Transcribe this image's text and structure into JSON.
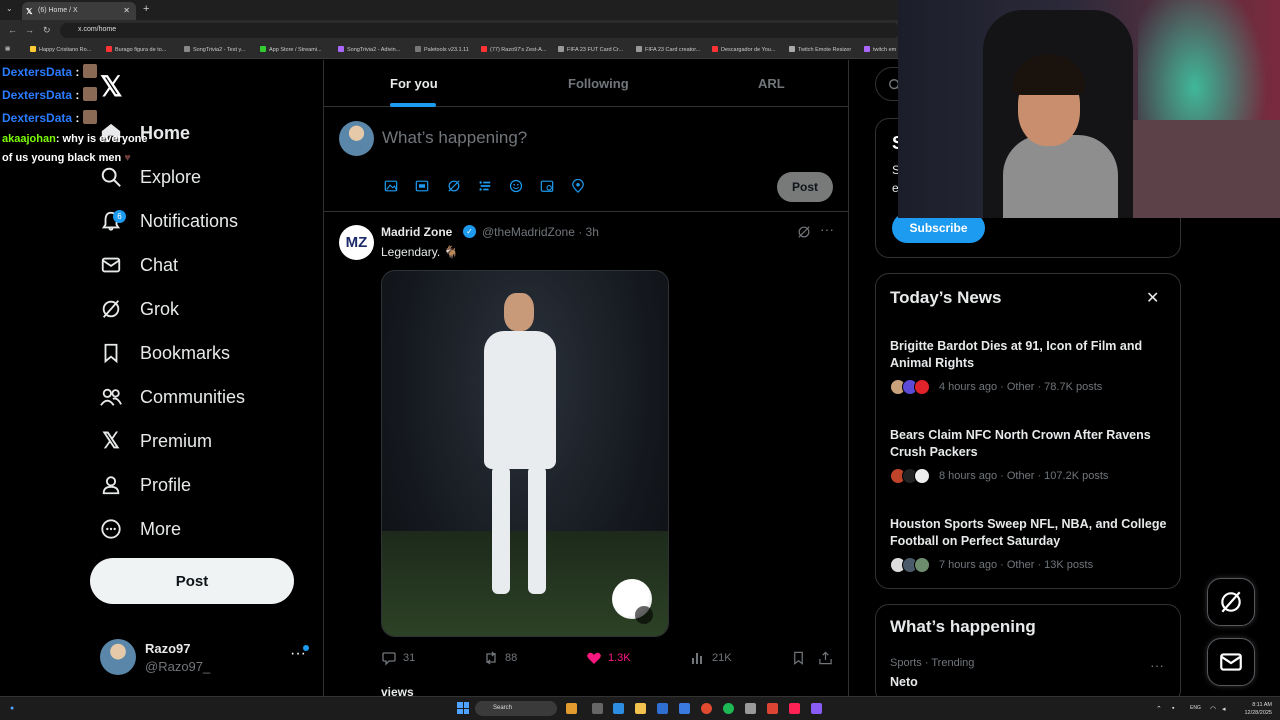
{
  "browser": {
    "tab_title": "(6) Home / X",
    "address": "x.com/home",
    "bookmarks": [
      "Happy Cristiano Ro...",
      "Burago figura de to...",
      "SongTrivia2 - Test y...",
      "App Store / Streami...",
      "SongTrivia2 - Adivin...",
      "Paletools v23.1.11",
      "(77) Razo97's Zest-A...",
      "FIFA 23 FUT Card Cr...",
      "FIFA 23 Card creator...",
      "Descargador de You...",
      "Twitch Emote Resizer",
      "twitch em"
    ]
  },
  "chat": [
    {
      "user": "DextersData",
      "text": ":"
    },
    {
      "user": "DextersData",
      "text": ":"
    },
    {
      "user": "DextersData",
      "text": ":"
    },
    {
      "user": "akaajohan",
      "text": ": why is everyone"
    },
    {
      "user": "",
      "text": "of us young black men"
    }
  ],
  "nav": {
    "items": [
      {
        "label": "Home",
        "icon": "home-icon"
      },
      {
        "label": "Explore",
        "icon": "search-icon"
      },
      {
        "label": "Notifications",
        "icon": "bell-icon",
        "badge": "6"
      },
      {
        "label": "Chat",
        "icon": "mail-icon"
      },
      {
        "label": "Grok",
        "icon": "grok-icon"
      },
      {
        "label": "Bookmarks",
        "icon": "bookmark-icon"
      },
      {
        "label": "Communities",
        "icon": "people-icon"
      },
      {
        "label": "Premium",
        "icon": "x-icon"
      },
      {
        "label": "Profile",
        "icon": "person-icon"
      },
      {
        "label": "More",
        "icon": "more-circle-icon"
      }
    ],
    "post_label": "Post",
    "account": {
      "name": "Razo97",
      "handle": "@Razo97_",
      "more": "···"
    }
  },
  "feed": {
    "tabs": [
      "For you",
      "Following",
      "ARL"
    ],
    "compose_placeholder": "What’s happening?",
    "compose_post": "Post",
    "tweet": {
      "avatar_text": "MZ",
      "name": "Madrid Zone",
      "handle": "@theMadridZone · 3h",
      "text": "Legendary. 🐐",
      "replies": "31",
      "retweets": "88",
      "likes": "1.3K",
      "views": "21K"
    },
    "next_tweet_peek": "views"
  },
  "right": {
    "subscribe": {
      "label": "Subscribe",
      "heading": "S",
      "line1": "S",
      "line2": "e"
    },
    "todays_news": {
      "title": "Today’s News",
      "close": "✕",
      "items": [
        {
          "title": "Brigitte Bardot Dies at 91, Icon of Film and Animal Rights",
          "meta": "4 hours ago · Other · 78.7K posts"
        },
        {
          "title": "Bears Claim NFC North Crown After Ravens Crush Packers",
          "meta": "8 hours ago · Other · 107.2K posts"
        },
        {
          "title": "Houston Sports Sweep NFL, NBA, and College Football on Perfect Saturday",
          "meta": "7 hours ago · Other · 13K posts"
        }
      ]
    },
    "whats_happening": {
      "title": "What’s happening",
      "category": "Sports · Trending",
      "trend": "Neto",
      "more": "···"
    }
  },
  "taskbar": {
    "search": "Search",
    "lang": "ENG",
    "time": "8:11 AM",
    "date": "12/28/2025"
  },
  "colors": {
    "accent": "#1d9bf0",
    "like": "#f91880",
    "background": "#000000"
  }
}
